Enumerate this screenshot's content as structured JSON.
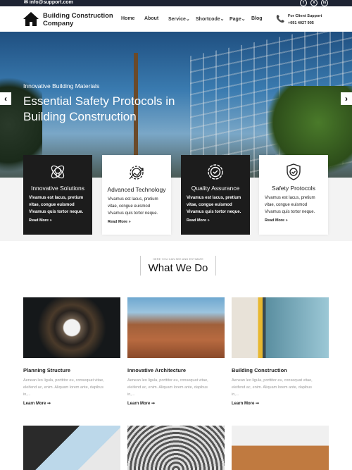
{
  "topbar": {
    "email": "info@support.com",
    "social": [
      "f",
      "X",
      "in"
    ]
  },
  "header": {
    "brand_line1": "Building Construction",
    "brand_line2": "Company",
    "nav": [
      "Home",
      "About",
      "Service",
      "Shortcode",
      "Page",
      "Blog"
    ],
    "support_label": "For Client Support",
    "support_phone": "+091 4027 905"
  },
  "hero": {
    "subtitle": "Innovative Building Materials",
    "title": "Essential Safety Protocols in Building Construction",
    "prev": "‹",
    "next": "›"
  },
  "features": [
    {
      "title": "Innovative Solutions",
      "text": "Vivamus est lacus, pretium vitae, congue euismod Vivamus quis tortor neque.",
      "link": "Read More »",
      "icon": "lightbulb-atom-icon",
      "style": "dark"
    },
    {
      "title": "Advanced Technology",
      "text": "Vivamus est lacus, pretium vitae, congue euismod Vivamus quis tortor neque.",
      "link": "Read More »",
      "icon": "gear-chart-icon",
      "style": "light"
    },
    {
      "title": "Quality Assurance",
      "text": "Vivamus est lacus, pretium vitae, congue euismod Vivamus quis tortor neque.",
      "link": "Read More »",
      "icon": "badge-check-icon",
      "style": "dark"
    },
    {
      "title": "Safety Protocols",
      "text": "Vivamus est lacus, pretium vitae, congue euismod Vivamus quis tortor neque.",
      "link": "Read More »",
      "icon": "shield-check-icon",
      "style": "light"
    }
  ],
  "what_we_do": {
    "subtitle": "HERE YOU CAN SEE AND ESTIMATE",
    "title": "What We Do"
  },
  "services": [
    {
      "title": "Planning Structure",
      "text": "Aenean leo ligula, porttitor eu, consequat vitae, eleifend ac, enim. Aliquam lorem ante, dapibus in,...",
      "link": "Learn More ➞"
    },
    {
      "title": "Innovative Architecture",
      "text": "Aenean leo ligula, porttitor eu, consequat vitae, eleifend ac, enim. Aliquam lorem ante, dapibus in,...",
      "link": "Learn More ➞"
    },
    {
      "title": "Building Construction",
      "text": "Aenean leo ligula, porttitor eu, consequat vitae, eleifend ac, enim. Aliquam lorem ante, dapibus in,...",
      "link": "Learn More ➞"
    }
  ],
  "colors": {
    "topbar": "#1e2433",
    "dark_card": "#1c1c1c"
  }
}
